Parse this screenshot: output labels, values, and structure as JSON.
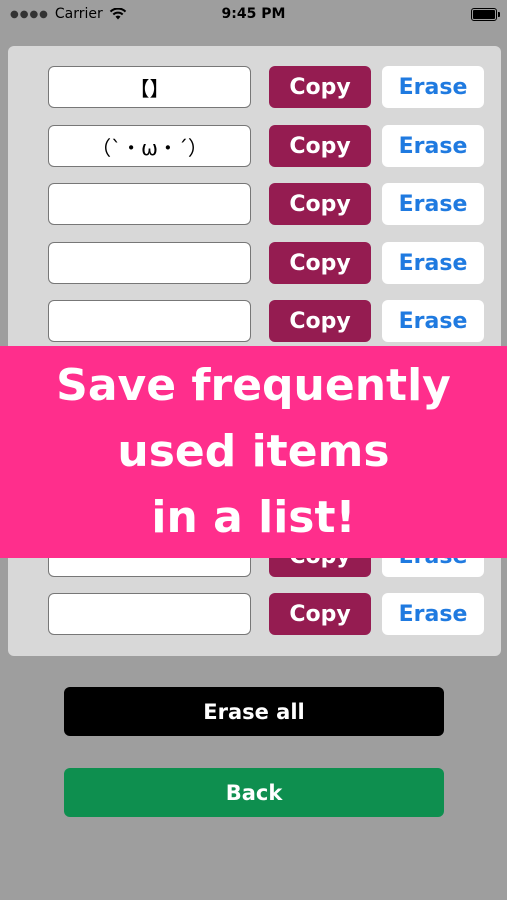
{
  "status_bar": {
    "carrier": "Carrier",
    "time": "9:45 PM"
  },
  "rows": [
    {
      "value": "【】",
      "copy_label": "Copy",
      "erase_label": "Erase"
    },
    {
      "value": "（`・ω・´）",
      "copy_label": "Copy",
      "erase_label": "Erase"
    },
    {
      "value": "",
      "copy_label": "Copy",
      "erase_label": "Erase"
    },
    {
      "value": "",
      "copy_label": "Copy",
      "erase_label": "Erase"
    },
    {
      "value": "",
      "copy_label": "Copy",
      "erase_label": "Erase"
    },
    {
      "value": "",
      "copy_label": "Copy",
      "erase_label": "Erase"
    },
    {
      "value": "",
      "copy_label": "Copy",
      "erase_label": "Erase"
    }
  ],
  "banner": {
    "line1": "Save frequently",
    "line2": "used items",
    "line3": "in a list!"
  },
  "footer": {
    "erase_all_label": "Erase all",
    "back_label": "Back"
  },
  "colors": {
    "copy_button": "#951c51",
    "erase_text": "#1f7ae0",
    "banner": "#ff2e8c",
    "erase_all_button": "#000000",
    "back_button": "#0e8f4f"
  },
  "icons": {
    "signal": "signal-dots-icon",
    "wifi": "wifi-icon",
    "battery": "battery-icon"
  }
}
